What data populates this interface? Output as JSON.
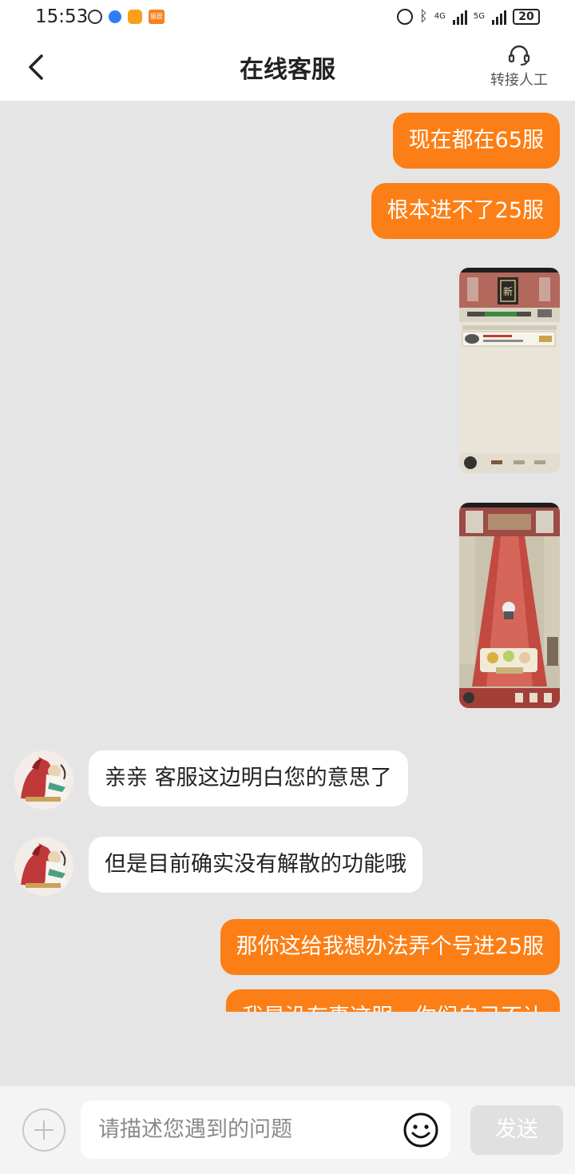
{
  "status_bar": {
    "time": "15:53",
    "app_badge": "丽居",
    "net1": "4G",
    "net2": "5G",
    "battery": "20"
  },
  "header": {
    "title": "在线客服",
    "transfer_label": "转接人工"
  },
  "messages": [
    {
      "direction": "out",
      "type": "text",
      "text": "现在都在65服"
    },
    {
      "direction": "out",
      "type": "text",
      "text": "根本进不了25服"
    },
    {
      "direction": "out",
      "type": "image",
      "image": "game-server-list-screenshot"
    },
    {
      "direction": "out",
      "type": "image",
      "image": "game-palace-hall-screenshot"
    },
    {
      "direction": "in",
      "type": "text",
      "text": "亲亲  客服这边明白您的意思了"
    },
    {
      "direction": "in",
      "type": "text",
      "text": "但是目前确实没有解散的功能哦"
    },
    {
      "direction": "out",
      "type": "text",
      "text": "那你这给我想办法弄个号进25服"
    },
    {
      "direction": "out",
      "type": "text",
      "text": "我是没有事这服，你们自己不让"
    }
  ],
  "input": {
    "placeholder": "请描述您遇到的问题",
    "send_label": "发送"
  },
  "colors": {
    "outgoing_bubble": "#fb7f16",
    "incoming_bubble": "#ffffff",
    "chat_background": "#e5e5e5"
  }
}
